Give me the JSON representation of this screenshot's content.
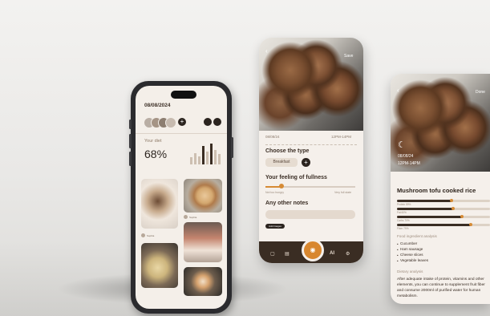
{
  "phone_feed": {
    "date": "08/08/2024",
    "diet_label": "Your diet",
    "diet_percent": "68%",
    "plus_symbol": "+",
    "chart_bars": [
      0.35,
      0.55,
      0.4,
      0.9,
      0.6,
      1.0,
      0.7,
      0.5
    ],
    "post_user": "Sophia",
    "post_user_alt": "Sophia"
  },
  "phone_log": {
    "back_icon": "chevron-left-icon",
    "save_label": "Save",
    "date": "08/08/24",
    "time": "12PM-14PM",
    "type_heading": "Choose the type",
    "type_chip": "Breakfast",
    "plus_symbol": "+",
    "fullness_heading": "Your feeling of fullness",
    "fullness_level": 0.18,
    "fullness_min": "Not too hungry",
    "fullness_max": "Very full state",
    "notes_heading": "Any other notes",
    "add_images": "Add images",
    "tabs": [
      "camera-icon",
      "calendar-icon",
      "camera-add-icon",
      "ai-icon",
      "settings-icon"
    ],
    "ai_tab_label": "AI"
  },
  "phone_detail": {
    "back_icon": "chevron-left-icon",
    "done_label": "Done",
    "date": "08/08/24",
    "time": "12PM-14PM",
    "title": "Mushroom tofu cooked rice",
    "nutrients": [
      {
        "label": "Protein 59%",
        "value": 0.59
      },
      {
        "label": "Fat 60%",
        "value": 0.6
      },
      {
        "label": "Carbs 70%",
        "value": 0.7
      },
      {
        "label": "Fiber 79%",
        "value": 0.79
      }
    ],
    "ingredients_heading": "Food ingredient analysis",
    "ingredients": [
      "Cucumber",
      "Ham sausage",
      "Cheese slices",
      "Vegetable leaves"
    ],
    "dietary_heading": "Dietary analysis",
    "dietary_text": "After adequate intake of protein, vitamins and other elements, you can continue to supplement fruit fiber and consume 2000ml of purified water for human metabolism."
  },
  "colors": {
    "accent": "#d68b35",
    "dark": "#2b241f",
    "background": "#f5f0eb"
  }
}
